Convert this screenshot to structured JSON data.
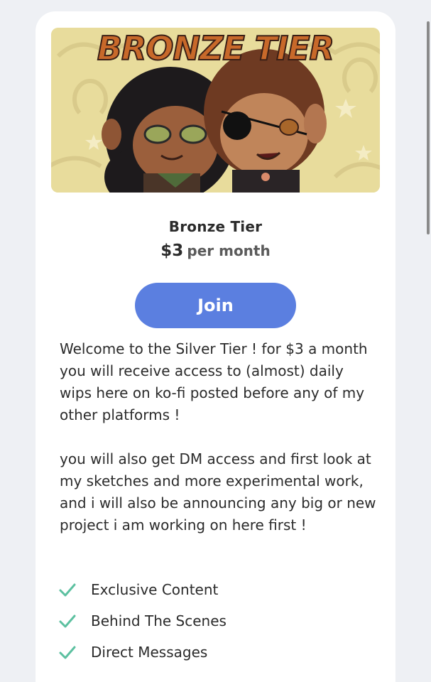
{
  "tier": {
    "banner_title": "BRONZE TIER",
    "name": "Bronze Tier",
    "price": "$3",
    "period": "per month",
    "join_label": "Join",
    "description": [
      "Welcome to the Silver Tier ! for $3 a month you will receive access to (almost) daily wips here on ko-fi posted before any of my other platforms !",
      "you will also get DM access and first look at my sketches and more experimental work, and i will also be announcing any big or new project i am working on here first !"
    ],
    "features": [
      {
        "label": "Exclusive Content",
        "icon": "check-icon"
      },
      {
        "label": "Behind The Scenes",
        "icon": "check-icon"
      },
      {
        "label": "Direct Messages",
        "icon": "check-icon"
      }
    ]
  },
  "colors": {
    "page_bg": "#eef0f4",
    "card_bg": "#ffffff",
    "join_button": "#5b7fe0",
    "check": "#5cc0a0",
    "banner_bg": "#e8dc9c",
    "banner_title": "#c8692a"
  }
}
